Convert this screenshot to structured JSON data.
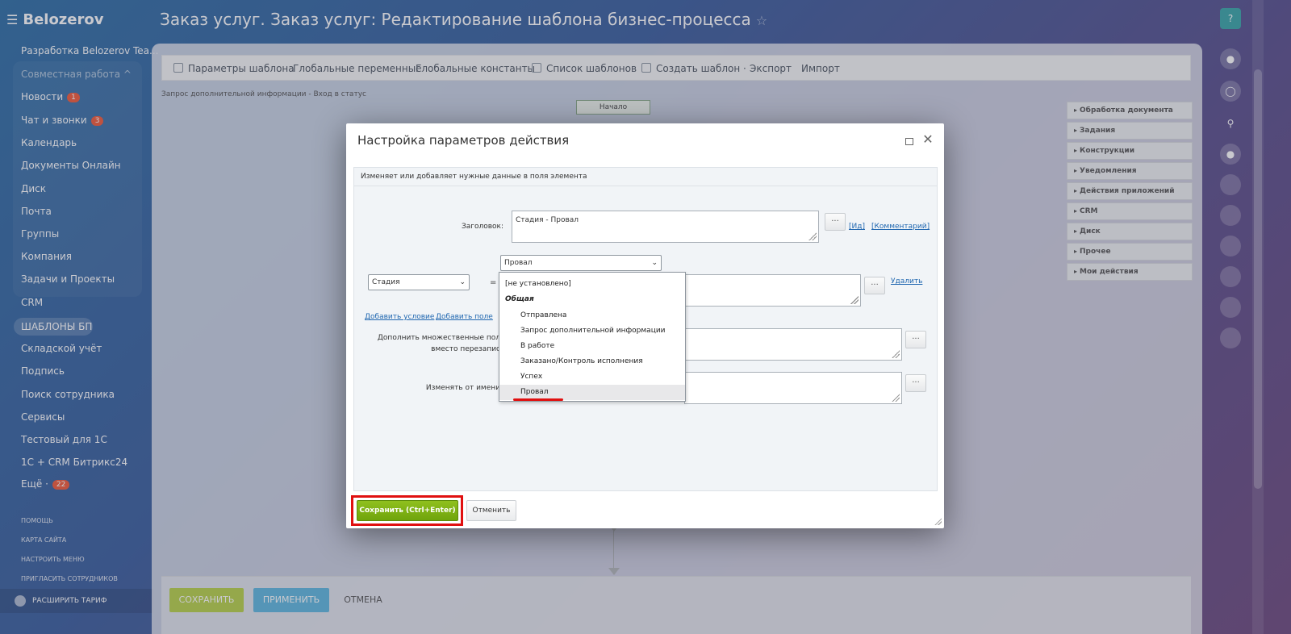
{
  "app": {
    "logo": "Belozerov",
    "page_title": "Заказ услуг. Заказ услуг: Редактирование шаблона бизнес-процесса"
  },
  "sidebar": {
    "items": [
      {
        "label": "Разработка Belozerov Tea..."
      },
      {
        "label": "Совместная работа ^"
      },
      {
        "label": "Новости",
        "badge": "1"
      },
      {
        "label": "Чат и звонки",
        "badge": "3"
      },
      {
        "label": "Календарь"
      },
      {
        "label": "Документы Онлайн"
      },
      {
        "label": "Диск"
      },
      {
        "label": "Почта"
      },
      {
        "label": "Группы"
      },
      {
        "label": "Компания"
      },
      {
        "label": "Задачи и Проекты"
      },
      {
        "label": "CRM"
      },
      {
        "label": "ШАБЛОНЫ БП"
      },
      {
        "label": "Складской учёт"
      },
      {
        "label": "Подпись"
      },
      {
        "label": "Поиск сотрудника"
      },
      {
        "label": "Сервисы"
      },
      {
        "label": "Тестовый для 1С"
      },
      {
        "label": "1С + CRM Битрикс24"
      },
      {
        "label": "Ещё ·",
        "badge": "22"
      }
    ],
    "footer": [
      "ПОМОЩЬ",
      "КАРТА САЙТА",
      "НАСТРОИТЬ МЕНЮ",
      "ПРИГЛАСИТЬ СОТРУДНИКОВ"
    ],
    "upgrade": "РАСШИРИТЬ ТАРИФ"
  },
  "toolbar": {
    "items": [
      "Параметры шаблона",
      "Глобальные переменные",
      "Глобальные константы",
      "Список шаблонов",
      "Создать шаблон ·",
      "Экспорт",
      "Импорт"
    ]
  },
  "workspace": {
    "breadcrumb": "Запрос дополнительной информации - Вход в статус",
    "start_node": "Начало"
  },
  "right_panel": {
    "items": [
      "Обработка документа",
      "Задания",
      "Конструкции",
      "Уведомления",
      "Действия приложений",
      "CRM",
      "Диск",
      "Прочее",
      "Мои действия"
    ]
  },
  "bottom_bar": {
    "save": "СОХРАНИТЬ",
    "apply": "ПРИМЕНИТЬ",
    "cancel": "ОТМЕНА"
  },
  "dialog": {
    "title": "Настройка параметров действия",
    "description": "Изменяет или добавляет нужные данные в поля элемента",
    "title_label": "Заголовок:",
    "title_value": "Стадия - Провал",
    "dots": "...",
    "link_id": "[Ид]",
    "link_comment": "[Комментарий]",
    "field_select": "Стадия",
    "equals": "=",
    "value_select": "Провал",
    "delete_link": "Удалить",
    "add_condition": "Добавить условие",
    "add_field": "Добавить поле",
    "multi_label_1": "Дополнить множественные пол",
    "multi_label_2": "вместо перезапис",
    "modify_label": "Изменять от имени",
    "save_button": "Сохранить (Ctrl+Enter)",
    "cancel_button": "Отменить"
  },
  "dropdown": {
    "options": [
      {
        "label": "[не установлено]",
        "type": "option"
      },
      {
        "label": "Общая",
        "type": "group"
      },
      {
        "label": "Отправлена",
        "type": "option"
      },
      {
        "label": "Запрос дополнительной информации",
        "type": "option"
      },
      {
        "label": "В работе",
        "type": "option"
      },
      {
        "label": "Заказано/Контроль исполнения",
        "type": "option"
      },
      {
        "label": "Успех",
        "type": "option"
      },
      {
        "label": "Провал",
        "type": "option",
        "selected": true
      }
    ]
  },
  "colors": {
    "accent_green": "#7db314",
    "highlight_red": "#e01010",
    "link_blue": "#2067b0"
  }
}
